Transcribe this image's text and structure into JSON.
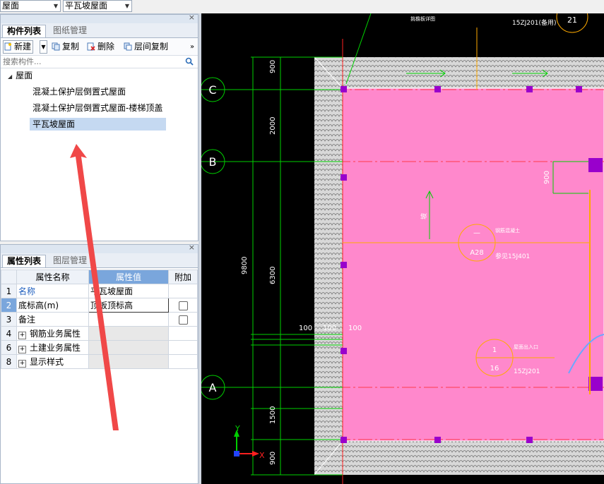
{
  "top_combos": {
    "first_value": "屋面",
    "second_value": "平瓦坡屋面"
  },
  "component_panel": {
    "tabs": [
      "构件列表",
      "图纸管理"
    ],
    "toolbar": {
      "new_label": "新建",
      "copy_label": "复制",
      "delete_label": "删除",
      "floor_copy_label": "层间复制",
      "more_label": "»"
    },
    "search_placeholder": "搜索构件...",
    "tree": {
      "root": "屋面",
      "items": [
        "混凝土保护层倒置式屋面",
        "混凝土保护层倒置式屋面-楼梯顶盖",
        "平瓦坡屋面"
      ],
      "selected_index": 2
    }
  },
  "property_panel": {
    "tabs": [
      "属性列表",
      "图层管理"
    ],
    "headers": {
      "name": "属性名称",
      "value": "属性值",
      "extra": "附加"
    },
    "rows": [
      {
        "no": "1",
        "name": "名称",
        "value": "平瓦坡屋面",
        "expand": "",
        "checkbox": false
      },
      {
        "no": "2",
        "name": "底标高(m)",
        "value": "顶板顶标高",
        "expand": "",
        "checkbox": true
      },
      {
        "no": "3",
        "name": "备注",
        "value": "",
        "expand": "",
        "checkbox": true
      },
      {
        "no": "4",
        "name": "钢筋业务属性",
        "value": "",
        "expand": "+",
        "checkbox": false
      },
      {
        "no": "6",
        "name": "土建业务属性",
        "value": "",
        "expand": "+",
        "checkbox": false
      },
      {
        "no": "8",
        "name": "显示样式",
        "value": "",
        "expand": "+",
        "checkbox": false
      }
    ]
  },
  "cad": {
    "axes": {
      "c": "C",
      "b": "B",
      "a": "A"
    },
    "dims": {
      "d900_top": "900",
      "d2000": "2000",
      "d6300": "6300",
      "d9800": "9800",
      "d1500": "1500",
      "d900_bot": "900",
      "d900_right": "900",
      "d100a": "100",
      "d100b": "100",
      "d100c": "100"
    },
    "callouts": {
      "c21_num": "21",
      "c21_ref": "15ZJ201(备用)",
      "c21_title": "挑檐板详图",
      "a28_top": "—",
      "a28_num": "A28",
      "a28_title": "钢筋混凝土",
      "a28_ref": "参见15J401",
      "c16_top": "1",
      "c16_num": "16",
      "c16_title": "屋面出入口",
      "c16_ref": "15ZJ201"
    },
    "slope_label": "坡",
    "ucs": {
      "x": "X",
      "y": "Y"
    }
  },
  "colors": {
    "roof_fill": "#ff88cc",
    "tab_selected": "#c5d9f1",
    "header_blue": "#7aa6dc",
    "cad_bg": "#000000"
  }
}
